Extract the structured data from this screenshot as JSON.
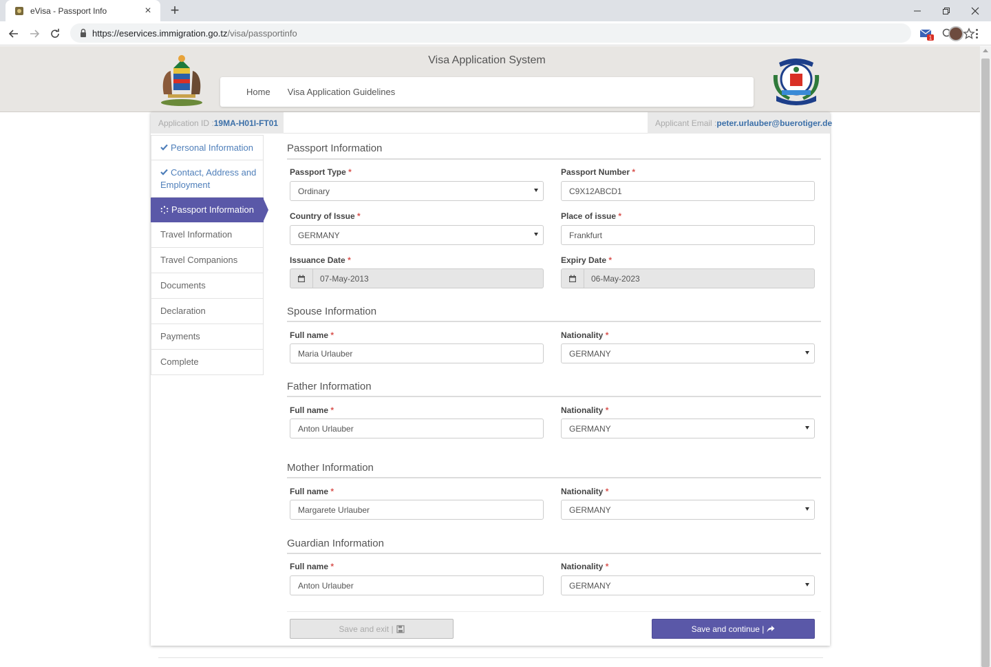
{
  "browser": {
    "tab_title": "eVisa - Passport Info",
    "url_host": "https://eservices.immigration.go.tz",
    "url_path": "/visa/passportinfo",
    "extension_badge": "1"
  },
  "header": {
    "site_title": "Visa Application System",
    "nav": [
      "Home",
      "Visa Application Guidelines"
    ]
  },
  "application": {
    "id_label": "Application ID : ",
    "id_value": "19MA-H01I-FT01",
    "email_label": "Applicant Email : ",
    "email_value": "peter.urlauber@buerotiger.de"
  },
  "sidebar": {
    "items": [
      {
        "label": "Personal Information",
        "state": "done"
      },
      {
        "label": "Contact, Address and Employment",
        "state": "done"
      },
      {
        "label": "Passport Information",
        "state": "active"
      },
      {
        "label": "Travel Information",
        "state": "pending"
      },
      {
        "label": "Travel Companions",
        "state": "pending"
      },
      {
        "label": "Documents",
        "state": "pending"
      },
      {
        "label": "Declaration",
        "state": "pending"
      },
      {
        "label": "Payments",
        "state": "pending"
      },
      {
        "label": "Complete",
        "state": "pending"
      }
    ]
  },
  "passport": {
    "title": "Passport Information",
    "type_label": "Passport Type",
    "type_value": "Ordinary",
    "number_label": "Passport Number",
    "number_value": "C9X12ABCD1",
    "country_label": "Country of Issue",
    "country_value": "GERMANY",
    "place_label": "Place of issue",
    "place_value": "Frankfurt",
    "issuance_label": "Issuance Date",
    "issuance_value": "07-May-2013",
    "expiry_label": "Expiry Date",
    "expiry_value": "06-May-2023"
  },
  "spouse": {
    "title": "Spouse Information",
    "name_label": "Full name",
    "name_value": "Maria Urlauber",
    "nationality_label": "Nationality",
    "nationality_value": "GERMANY"
  },
  "father": {
    "title": "Father Information",
    "name_label": "Full name",
    "name_value": "Anton Urlauber",
    "nationality_label": "Nationality",
    "nationality_value": "GERMANY"
  },
  "mother": {
    "title": "Mother Information",
    "name_label": "Full name",
    "name_value": "Margarete Urlauber",
    "nationality_label": "Nationality",
    "nationality_value": "GERMANY"
  },
  "guardian": {
    "title": "Guardian Information",
    "name_label": "Full name",
    "name_value": "Anton Urlauber",
    "nationality_label": "Nationality",
    "nationality_value": "GERMANY"
  },
  "required_mark": "*",
  "buttons": {
    "save_exit": "Save and exit |",
    "save_continue": "Save and continue |"
  },
  "colors": {
    "accent": "#5a58a8",
    "link": "#4f7fba",
    "required": "#d9534f"
  }
}
